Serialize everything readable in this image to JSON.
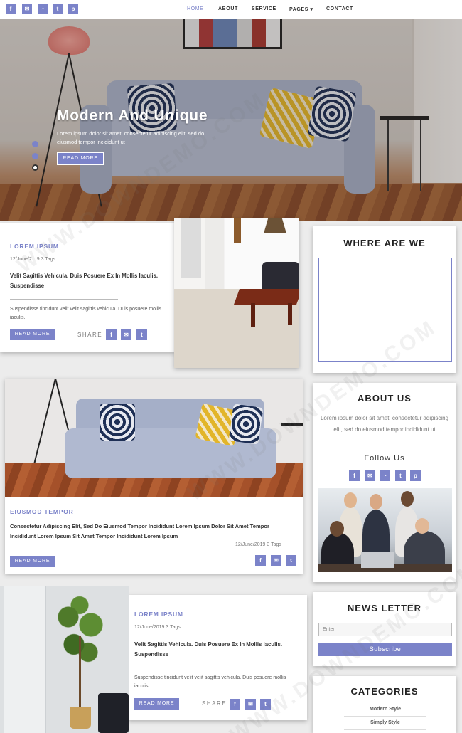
{
  "colors": {
    "accent": "#7b83c9",
    "page_bg": "#ececec",
    "card_bg": "#ffffff",
    "text": "#333333"
  },
  "social_icons": [
    "facebook-icon",
    "email-icon",
    "rss-icon",
    "twitter-icon",
    "pinterest-icon"
  ],
  "social_glyphs": {
    "facebook": "f",
    "email": "✉",
    "rss": "◔",
    "twitter": "t",
    "pinterest": "p"
  },
  "nav": {
    "home": "HOME",
    "about": "ABOUT",
    "service": "SERVICE",
    "pages": "PAGES ▾",
    "contact": "CONTACT"
  },
  "hero": {
    "title": "Modern And Unique",
    "text": "Lorem ipsum dolor sit amet, consectetur adipiscing elit, sed do eiusmod tempor incididunt ut",
    "button": "READ MORE"
  },
  "post1": {
    "kicker": "LOREM IPSUM",
    "meta": "12/June/2…9   3 Tags",
    "title": "Velit Sagittis Vehicula. Duis Posuere Ex In Mollis Iaculis. Suspendisse",
    "text": "Suspendisse tincidunt velit velit sagittis vehicula. Duis posuere mollis iaculis.",
    "button": "READ MORE",
    "share": "SHARE"
  },
  "post2": {
    "kicker": "EIUSMOD TEMPOR",
    "title": "Consectetur Adipiscing Elit, Sed Do Eiusmod Tempor Incididunt Lorem Ipsum Dolor Sit Amet Tempor Incididunt Lorem Ipsum Sit Amet Tempor Incididunt Lorem Ipsum",
    "meta": "12/June/2019    3 Tags",
    "button": "READ MORE"
  },
  "post3": {
    "kicker": "LOREM IPSUM",
    "meta": "12/June/2019   3 Tags",
    "title": "Velit Sagittis Vehicula. Duis Posuere Ex In Mollis Iaculis. Suspendisse",
    "text": "Suspendisse tincidunt velit velit sagittis vehicula. Duis posuere mollis iaculis.",
    "button": "READ MORE",
    "share": "SHARE"
  },
  "sidebar": {
    "where": "WHERE ARE WE",
    "about_title": "ABOUT US",
    "about_text": "Lorem ipsum dolor sit amet, consectetur adipiscing elit, sed do eiusmod tempor incididunt ut",
    "follow": "Follow Us",
    "newsletter_title": "NEWS LETTER",
    "newsletter_placeholder": "Enter",
    "subscribe": "Subscribe",
    "categories_title": "CATEGORIES",
    "categories": [
      "Modern Style",
      "Simply Style"
    ]
  },
  "watermark": "WWW.DOWNDEMO.COM"
}
